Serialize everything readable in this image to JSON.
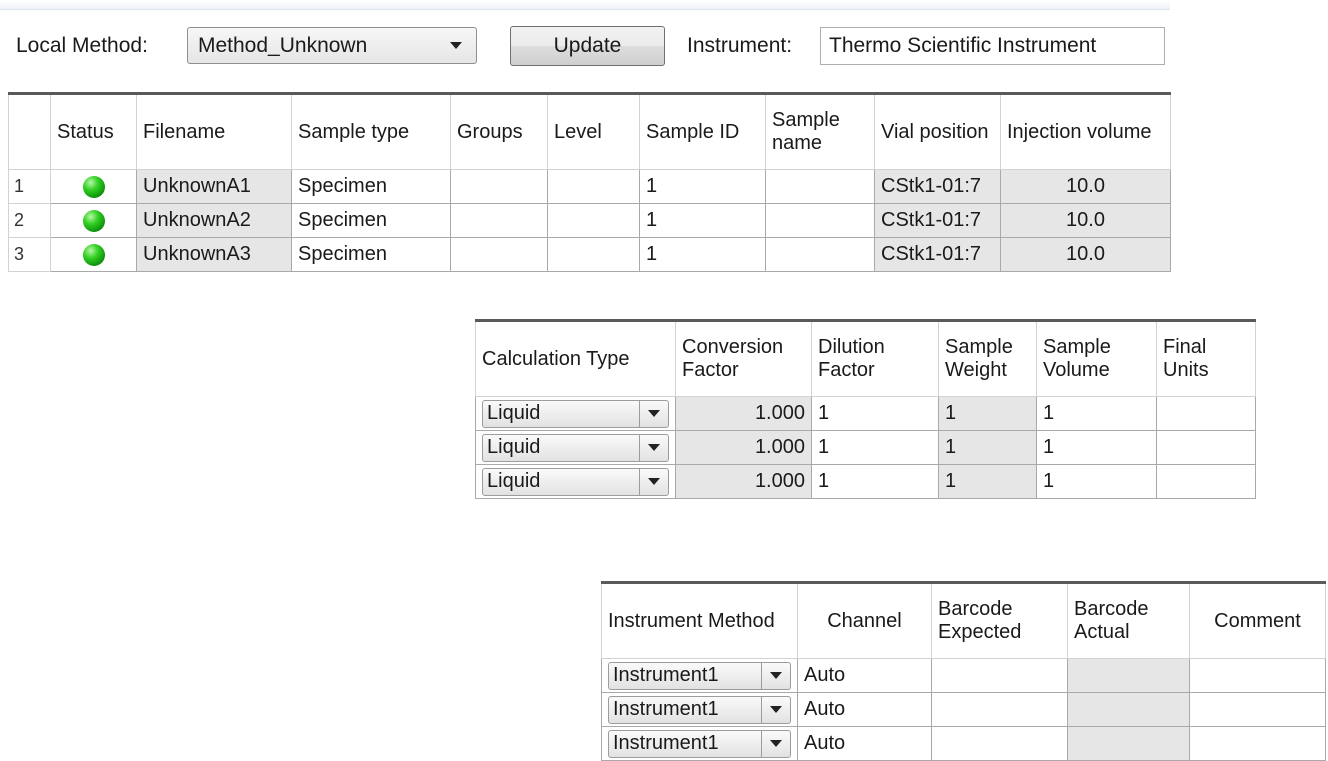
{
  "toolbar": {
    "local_method_label": "Local Method:",
    "local_method_value": "Method_Unknown",
    "update_label": "Update",
    "instrument_label": "Instrument:",
    "instrument_value": "Thermo Scientific Instrument"
  },
  "samples_table": {
    "headers": {
      "status": "Status",
      "filename": "Filename",
      "sample_type": "Sample type",
      "groups": "Groups",
      "level": "Level",
      "sample_id": "Sample ID",
      "sample_name": "Sample name",
      "vial_position": "Vial position",
      "injection_volume": "Injection volume"
    },
    "rows": [
      {
        "num": "1",
        "filename": "UnknownA1",
        "sample_type": "Specimen",
        "groups": "",
        "level": "",
        "sample_id": "1",
        "sample_name": "",
        "vial_position": "CStk1-01:7",
        "injection_volume": "10.0"
      },
      {
        "num": "2",
        "filename": "UnknownA2",
        "sample_type": "Specimen",
        "groups": "",
        "level": "",
        "sample_id": "1",
        "sample_name": "",
        "vial_position": "CStk1-01:7",
        "injection_volume": "10.0"
      },
      {
        "num": "3",
        "filename": "UnknownA3",
        "sample_type": "Specimen",
        "groups": "",
        "level": "",
        "sample_id": "1",
        "sample_name": "",
        "vial_position": "CStk1-01:7",
        "injection_volume": "10.0"
      }
    ]
  },
  "calc_table": {
    "headers": {
      "calculation_type": "Calculation Type",
      "conversion_factor": "Conversion Factor",
      "dilution_factor": "Dilution Factor",
      "sample_weight": "Sample Weight",
      "sample_volume": "Sample Volume",
      "final_units": "Final Units"
    },
    "rows": [
      {
        "calculation_type": "Liquid",
        "conversion_factor": "1.000",
        "dilution_factor": "1",
        "sample_weight": "1",
        "sample_volume": "1",
        "final_units": ""
      },
      {
        "calculation_type": "Liquid",
        "conversion_factor": "1.000",
        "dilution_factor": "1",
        "sample_weight": "1",
        "sample_volume": "1",
        "final_units": ""
      },
      {
        "calculation_type": "Liquid",
        "conversion_factor": "1.000",
        "dilution_factor": "1",
        "sample_weight": "1",
        "sample_volume": "1",
        "final_units": ""
      }
    ]
  },
  "instrument_table": {
    "headers": {
      "instrument_method": "Instrument Method",
      "channel": "Channel",
      "barcode_expected": "Barcode Expected",
      "barcode_actual": "Barcode Actual",
      "comment": "Comment"
    },
    "rows": [
      {
        "instrument_method": "Instrument1",
        "channel": "Auto",
        "barcode_expected": "",
        "barcode_actual": "",
        "comment": ""
      },
      {
        "instrument_method": "Instrument1",
        "channel": "Auto",
        "barcode_expected": "",
        "barcode_actual": "",
        "comment": ""
      },
      {
        "instrument_method": "Instrument1",
        "channel": "Auto",
        "barcode_expected": "",
        "barcode_actual": "",
        "comment": ""
      }
    ]
  },
  "icons": {
    "status": "status-ok-icon",
    "dropdown": "dropdown-arrow-icon"
  },
  "colors": {
    "status_green": "#2fcf23",
    "readonly_cell": "#e6e6e6"
  }
}
